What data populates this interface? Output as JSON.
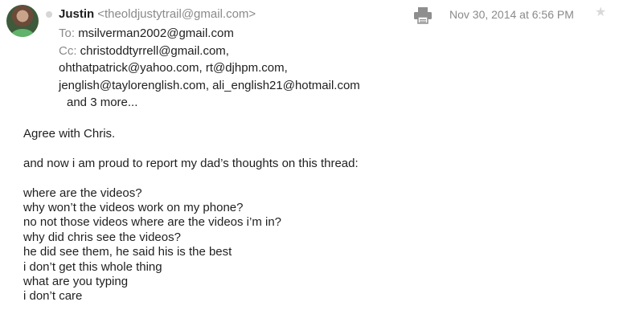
{
  "sender": {
    "name": "Justin",
    "email": "<theoldjustytrail@gmail.com>"
  },
  "recipients": {
    "to_label": "To:",
    "to": "msilverman2002@gmail.com",
    "cc_label": "Cc:",
    "cc_line1": "christoddtyrrell@gmail.com,",
    "cc_line2": "ohthatpatrick@yahoo.com,  rt@djhpm.com,",
    "cc_line3": "jenglish@taylorenglish.com,  ali_english21@hotmail.com",
    "more": "and 3 more..."
  },
  "date": "Nov 30, 2014 at 6:56 PM",
  "icons": {
    "avatar": "avatar",
    "status": "status-dot",
    "print": "printer-icon",
    "star": "star-icon"
  },
  "colors": {
    "secondary_text": "#8a8a8a",
    "star": "#d9d9d9",
    "print_icon": "#8e8e8e"
  },
  "message": {
    "line1": "Agree with Chris.",
    "line2": "and now i am proud to report my dad’s thoughts on this thread:",
    "quotes": [
      "where are the videos?",
      "why won’t the videos work on my phone?",
      "no not those videos where are the videos i’m in?",
      "why did chris see the videos?",
      "he did see them, he said his is the best",
      "i don’t get this whole thing",
      "what are you typing",
      "i don’t care"
    ]
  }
}
